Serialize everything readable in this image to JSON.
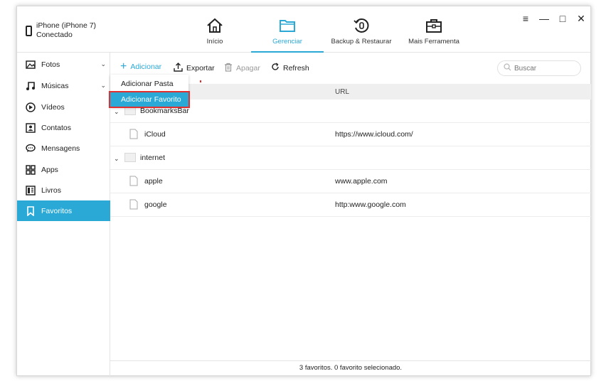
{
  "device": {
    "line1": "iPhone (iPhone 7)",
    "line2": "Conectado"
  },
  "nav": [
    {
      "label": "Início",
      "icon": "home-icon"
    },
    {
      "label": "Gerenciar",
      "icon": "folder-icon"
    },
    {
      "label": "Backup & Restaurar",
      "icon": "backup-restore-icon"
    },
    {
      "label": "Mais Ferramenta",
      "icon": "toolbox-icon"
    }
  ],
  "window_controls": {
    "menu": "≡",
    "minimize": "—",
    "maximize": "□",
    "close": "✕"
  },
  "sidebar": {
    "items": [
      {
        "label": "Fotos",
        "icon": "photo-icon",
        "chevron": "⌄"
      },
      {
        "label": "Músicas",
        "icon": "music-icon",
        "chevron": "⌄"
      },
      {
        "label": "Vídeos",
        "icon": "video-icon"
      },
      {
        "label": "Contatos",
        "icon": "contacts-icon"
      },
      {
        "label": "Mensagens",
        "icon": "messages-icon"
      },
      {
        "label": "Apps",
        "icon": "apps-icon"
      },
      {
        "label": "Livros",
        "icon": "books-icon"
      },
      {
        "label": "Favoritos",
        "icon": "bookmark-icon",
        "active": true
      }
    ]
  },
  "toolbar": {
    "add": "Adicionar",
    "export": "Exportar",
    "delete": "Apagar",
    "refresh": "Refresh",
    "search_placeholder": "Buscar"
  },
  "dropdown": {
    "add_folder": "Adicionar Pasta",
    "add_favorite": "Adicionar Favorito"
  },
  "table": {
    "col_url": "URL",
    "rows": [
      {
        "type": "folder",
        "name": "BookmarksBar",
        "url": ""
      },
      {
        "type": "file",
        "name": "iCloud",
        "url": "https://www.icloud.com/"
      },
      {
        "type": "folder",
        "name": "internet",
        "url": ""
      },
      {
        "type": "file",
        "name": "apple",
        "url": "www.apple.com"
      },
      {
        "type": "file",
        "name": "google",
        "url": "http:www.google.com"
      }
    ]
  },
  "status": "3 favoritos. 0 favorito selecionado.",
  "colors": {
    "accent": "#2aa9d6",
    "highlight_border": "#e03030"
  }
}
